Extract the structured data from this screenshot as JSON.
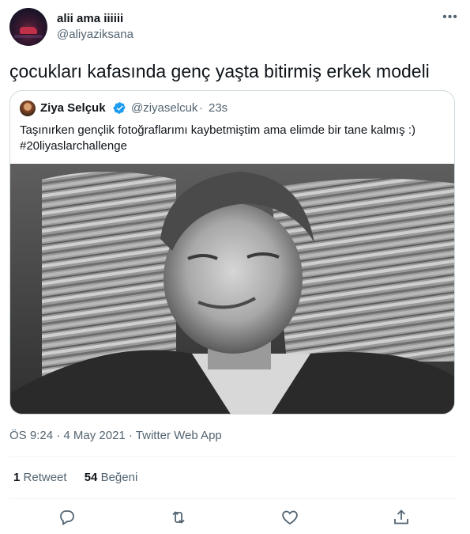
{
  "author": {
    "display_name": "alii ama iiiiii",
    "handle": "@aliyaziksana"
  },
  "tweet_text": "çocukları kafasında genç yaşta bitirmiş erkek modeli",
  "quoted": {
    "display_name": "Ziya Selçuk",
    "handle": "@ziyaselcuk",
    "separator": "·",
    "time": "23s",
    "text": "Taşınırken gençlik fotoğraflarımı kaybetmiştim ama elimde bir tane kalmış :)",
    "hashtag": "#20liyaslarchallenge",
    "photo_desc": "black-and-white-portrait-photo"
  },
  "meta": "ÖS 9:24 · 4 May 2021 · Twitter Web App",
  "stats": {
    "retweets_count": "1",
    "retweets_label": "Retweet",
    "likes_count": "54",
    "likes_label": "Beğeni"
  },
  "icons": {
    "more": "more-icon",
    "verified": "verified-badge-icon",
    "reply": "reply-icon",
    "retweet": "retweet-icon",
    "like": "like-icon",
    "share": "share-icon"
  },
  "colors": {
    "text": "#0f1419",
    "secondary": "#536471",
    "verified": "#1d9bf0",
    "border": "#cfd9de"
  }
}
